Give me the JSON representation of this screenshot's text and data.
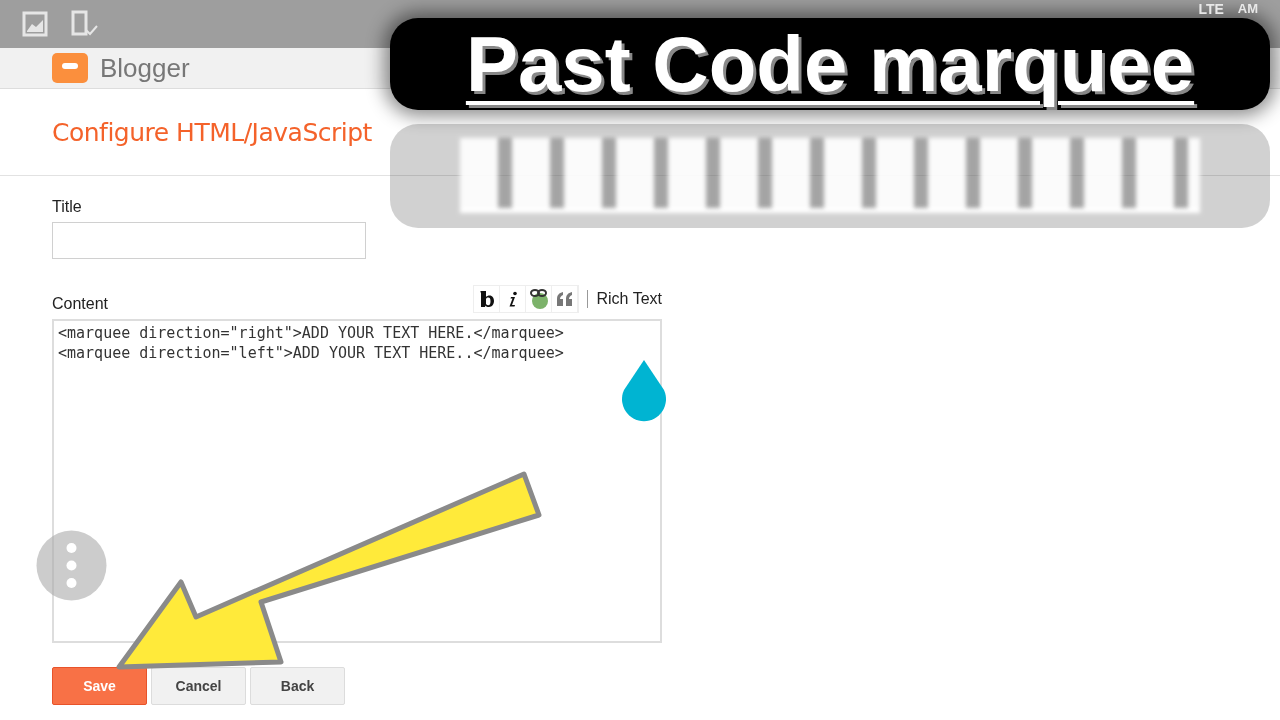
{
  "status_bar": {
    "network": "LTE",
    "time": "AM"
  },
  "header": {
    "brand": "Blogger"
  },
  "page_title": "Configure HTML/JavaScript",
  "form": {
    "title_label": "Title",
    "content_label": "Content",
    "toolbar": {
      "rich_text": "Rich Text"
    },
    "content_lines": [
      "<marquee direction=\"right\">ADD YOUR TEXT HERE.</marquee>",
      "<marquee direction=\"left\">ADD YOUR TEXT HERE..</marquee>"
    ]
  },
  "buttons": [
    {
      "label": "Save",
      "kind": "primary"
    },
    {
      "label": "Cancel",
      "kind": "secondary"
    },
    {
      "label": "Back",
      "kind": "secondary"
    }
  ],
  "overlay": {
    "headline": "Past Code marquee"
  }
}
